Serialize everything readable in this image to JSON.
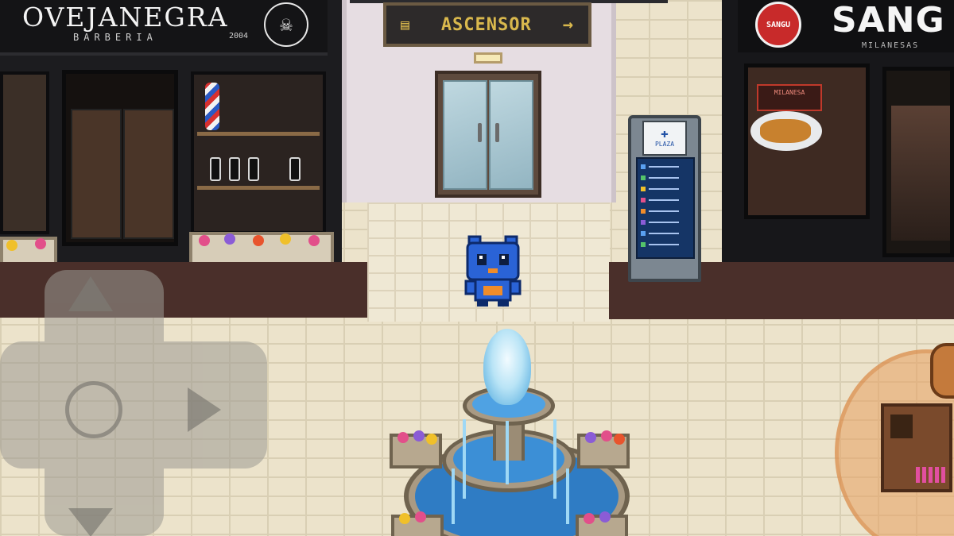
{
  "shops": {
    "barber": {
      "name": "OVEJANEGRA",
      "subtitle": "BARBERIA",
      "year": "2004",
      "logo_icon": "skull-crossed-razors-icon"
    },
    "restaurant": {
      "name": "SANG",
      "logo_line1": "SANGU",
      "logo_line2": "",
      "subtitle": "MILANESAS",
      "board_text": "MILANESA",
      "accent": "#c82a2a"
    }
  },
  "elevator": {
    "sign_label": "ASCENSOR",
    "sign_icon": "elevator-icon",
    "arrow": "→",
    "sign_text_color": "#d9b84d"
  },
  "kiosk": {
    "header_icon": "plus-icon",
    "header_label": "PLAZA"
  },
  "controls": {
    "dpad_icon": "dpad-icon",
    "action_icon": "action-button-icon"
  },
  "colors": {
    "player": "#2a63d6",
    "player_accent": "#f08c2a",
    "water": "#2f7cc4",
    "floor": "#ece3cb"
  }
}
